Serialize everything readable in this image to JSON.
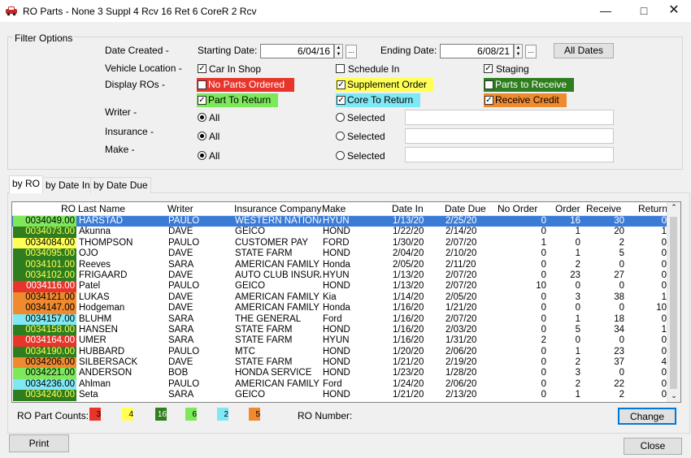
{
  "window": {
    "title": "RO Parts - None 3 Suppl 4 Rcv 16 Ret 6 CoreR 2 Rcv"
  },
  "filter": {
    "title": "Filter Options",
    "date_created_label": "Date Created -",
    "starting_label": "Starting Date:",
    "starting_value": "6/04/16",
    "ending_label": "Ending Date:",
    "ending_value": "6/08/21",
    "all_dates": "All Dates",
    "vehicle_location_label": "Vehicle Location -",
    "car_in_shop": "Car In Shop",
    "schedule_in": "Schedule In",
    "staging": "Staging",
    "display_ros_label": "Display ROs -",
    "no_parts": "No Parts Ordered",
    "supplement": "Supplement Order",
    "parts_to_receive": "Parts to Receive",
    "part_to_return": "Part To Return",
    "core_to_return": "Core To Return",
    "receive_credit": "Receive Credit",
    "writer_label": "Writer -",
    "insurance_label": "Insurance -",
    "make_label": "Make -",
    "all": "All",
    "selected": "Selected"
  },
  "tabs": [
    "by RO",
    "by Date In",
    "by Date Due"
  ],
  "colors": {
    "red": "#e8352b",
    "yellow": "#ffff55",
    "darkgreen": "#2e7d1e",
    "lightgreen": "#7ce85a",
    "cyan": "#7fe8f5",
    "orange": "#f08a2f"
  },
  "grid": {
    "headers": [
      "RO",
      "Last Name",
      "Writer",
      "Insurance Company",
      "Make",
      "Date In",
      "Date Due",
      "No Order",
      "Order",
      "Receive",
      "Return"
    ],
    "rows": [
      {
        "ro": "0034049.00",
        "color": "lightgreen",
        "last": "HARSTAD",
        "writer": "PAULO",
        "ins": "WESTERN NATIONAL",
        "make": "HYUN",
        "in": "1/13/20",
        "due": "2/25/20",
        "no": "0",
        "ord": "16",
        "rcv": "30",
        "ret": "0"
      },
      {
        "ro": "0034073.00",
        "color": "darkgreen",
        "last": "Akunna",
        "writer": "DAVE",
        "ins": "GEICO",
        "make": "HOND",
        "in": "1/22/20",
        "due": "2/14/20",
        "no": "0",
        "ord": "1",
        "rcv": "20",
        "ret": "1"
      },
      {
        "ro": "0034084.00",
        "color": "yellow",
        "last": "THOMPSON",
        "writer": "PAULO",
        "ins": "CUSTOMER PAY",
        "make": "FORD",
        "in": "1/30/20",
        "due": "2/07/20",
        "no": "1",
        "ord": "0",
        "rcv": "2",
        "ret": "0"
      },
      {
        "ro": "0034095.00",
        "color": "darkgreen",
        "last": "OJO",
        "writer": "DAVE",
        "ins": "STATE FARM",
        "make": "HOND",
        "in": "2/04/20",
        "due": "2/10/20",
        "no": "0",
        "ord": "1",
        "rcv": "5",
        "ret": "0"
      },
      {
        "ro": "0034101.00",
        "color": "darkgreen",
        "last": "Reeves",
        "writer": "SARA",
        "ins": "AMERICAN FAMILY",
        "make": "Honda",
        "in": "2/05/20",
        "due": "2/11/20",
        "no": "0",
        "ord": "2",
        "rcv": "0",
        "ret": "0"
      },
      {
        "ro": "0034102.00",
        "color": "darkgreen",
        "last": "FRIGAARD",
        "writer": "DAVE",
        "ins": "AUTO CLUB INSURANCE",
        "make": "HYUN",
        "in": "1/13/20",
        "due": "2/07/20",
        "no": "0",
        "ord": "23",
        "rcv": "27",
        "ret": "0"
      },
      {
        "ro": "0034116.00",
        "color": "red",
        "last": "Patel",
        "writer": "PAULO",
        "ins": "GEICO",
        "make": "HOND",
        "in": "1/13/20",
        "due": "2/07/20",
        "no": "10",
        "ord": "0",
        "rcv": "0",
        "ret": "0"
      },
      {
        "ro": "0034121.00",
        "color": "orange",
        "last": "LUKAS",
        "writer": "DAVE",
        "ins": "AMERICAN FAMILY",
        "make": "Kia",
        "in": "1/14/20",
        "due": "2/05/20",
        "no": "0",
        "ord": "3",
        "rcv": "38",
        "ret": "1"
      },
      {
        "ro": "0034147.00",
        "color": "orange",
        "last": "Hodgeman",
        "writer": "DAVE",
        "ins": "AMERICAN FAMILY",
        "make": "Honda",
        "in": "1/16/20",
        "due": "1/21/20",
        "no": "0",
        "ord": "0",
        "rcv": "0",
        "ret": "10"
      },
      {
        "ro": "0034157.00",
        "color": "cyan",
        "last": "BLUHM",
        "writer": "SARA",
        "ins": "THE GENERAL",
        "make": "Ford",
        "in": "1/16/20",
        "due": "2/07/20",
        "no": "0",
        "ord": "1",
        "rcv": "18",
        "ret": "0"
      },
      {
        "ro": "0034158.00",
        "color": "darkgreen",
        "last": "HANSEN",
        "writer": "SARA",
        "ins": "STATE FARM",
        "make": "HOND",
        "in": "1/16/20",
        "due": "2/03/20",
        "no": "0",
        "ord": "5",
        "rcv": "34",
        "ret": "1"
      },
      {
        "ro": "0034164.00",
        "color": "red",
        "last": "UMER",
        "writer": "SARA",
        "ins": "STATE FARM",
        "make": "HYUN",
        "in": "1/16/20",
        "due": "1/31/20",
        "no": "2",
        "ord": "0",
        "rcv": "0",
        "ret": "0"
      },
      {
        "ro": "0034190.00",
        "color": "darkgreen",
        "last": "HUBBARD",
        "writer": "PAULO",
        "ins": "MTC",
        "make": "HOND",
        "in": "1/20/20",
        "due": "2/06/20",
        "no": "0",
        "ord": "1",
        "rcv": "23",
        "ret": "0"
      },
      {
        "ro": "0034206.00",
        "color": "orange",
        "last": "SILBERSACK",
        "writer": "DAVE",
        "ins": "STATE FARM",
        "make": "HOND",
        "in": "1/21/20",
        "due": "2/19/20",
        "no": "0",
        "ord": "2",
        "rcv": "37",
        "ret": "4"
      },
      {
        "ro": "0034221.00",
        "color": "lightgreen",
        "last": "ANDERSON",
        "writer": "BOB",
        "ins": "HONDA SERVICE",
        "make": "HOND",
        "in": "1/23/20",
        "due": "1/28/20",
        "no": "0",
        "ord": "3",
        "rcv": "0",
        "ret": "0"
      },
      {
        "ro": "0034236.00",
        "color": "cyan",
        "last": "Ahlman",
        "writer": "PAULO",
        "ins": "AMERICAN FAMILY",
        "make": "Ford",
        "in": "1/24/20",
        "due": "2/06/20",
        "no": "0",
        "ord": "2",
        "rcv": "22",
        "ret": "0"
      },
      {
        "ro": "0034240.00",
        "color": "darkgreen",
        "last": "Seta",
        "writer": "SARA",
        "ins": "GEICO",
        "make": "HOND",
        "in": "1/21/20",
        "due": "2/13/20",
        "no": "0",
        "ord": "1",
        "rcv": "2",
        "ret": "0"
      }
    ]
  },
  "footer": {
    "counts_label": "RO Part Counts:",
    "counts": [
      {
        "value": "3",
        "color": "red"
      },
      {
        "value": "4",
        "color": "yellow"
      },
      {
        "value": "16",
        "color": "darkgreen"
      },
      {
        "value": "6",
        "color": "lightgreen"
      },
      {
        "value": "2",
        "color": "cyan"
      },
      {
        "value": "5",
        "color": "orange"
      }
    ],
    "ro_number_label": "RO Number:",
    "change": "Change",
    "print": "Print",
    "close": "Close"
  }
}
